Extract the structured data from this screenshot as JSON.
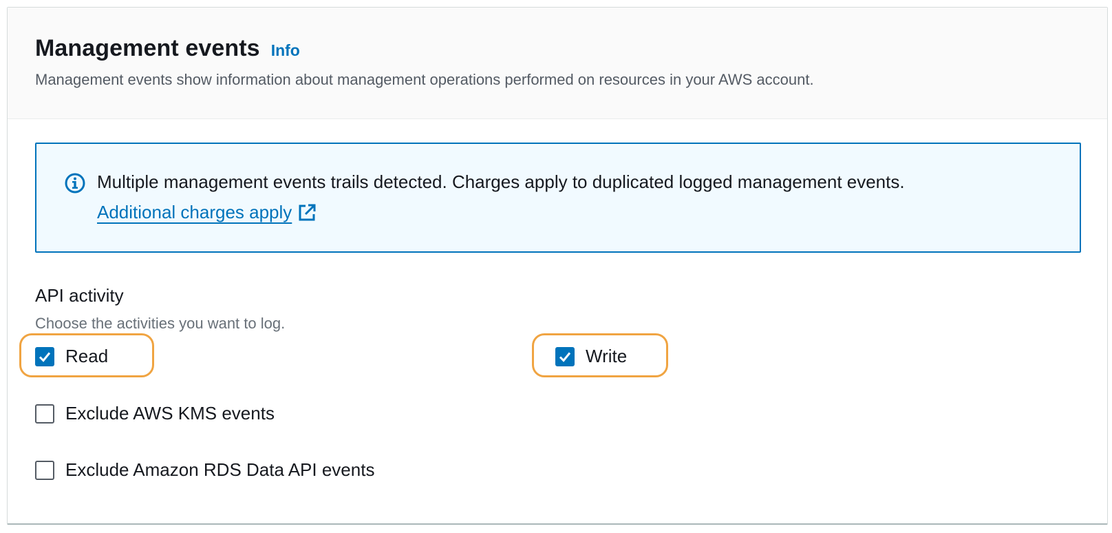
{
  "header": {
    "title": "Management events",
    "info_label": "Info",
    "description": "Management events show information about management operations performed on resources in your AWS account."
  },
  "alert": {
    "icon": "info-circle-icon",
    "message": "Multiple management events trails detected. Charges apply to duplicated logged management events.",
    "link_label": "Additional charges apply",
    "link_icon": "external-link-icon"
  },
  "api_activity": {
    "title": "API activity",
    "description": "Choose the activities you want to log.",
    "options": {
      "read": {
        "label": "Read",
        "checked": true,
        "highlighted": true
      },
      "write": {
        "label": "Write",
        "checked": true,
        "highlighted": true
      },
      "exclude_kms": {
        "label": "Exclude AWS KMS events",
        "checked": false
      },
      "exclude_rds": {
        "label": "Exclude Amazon RDS Data API events",
        "checked": false
      }
    }
  },
  "colors": {
    "link": "#0073bb",
    "alert_bg": "#f1faff",
    "checkbox_checked": "#0073bb",
    "highlight": "#f0a442"
  }
}
